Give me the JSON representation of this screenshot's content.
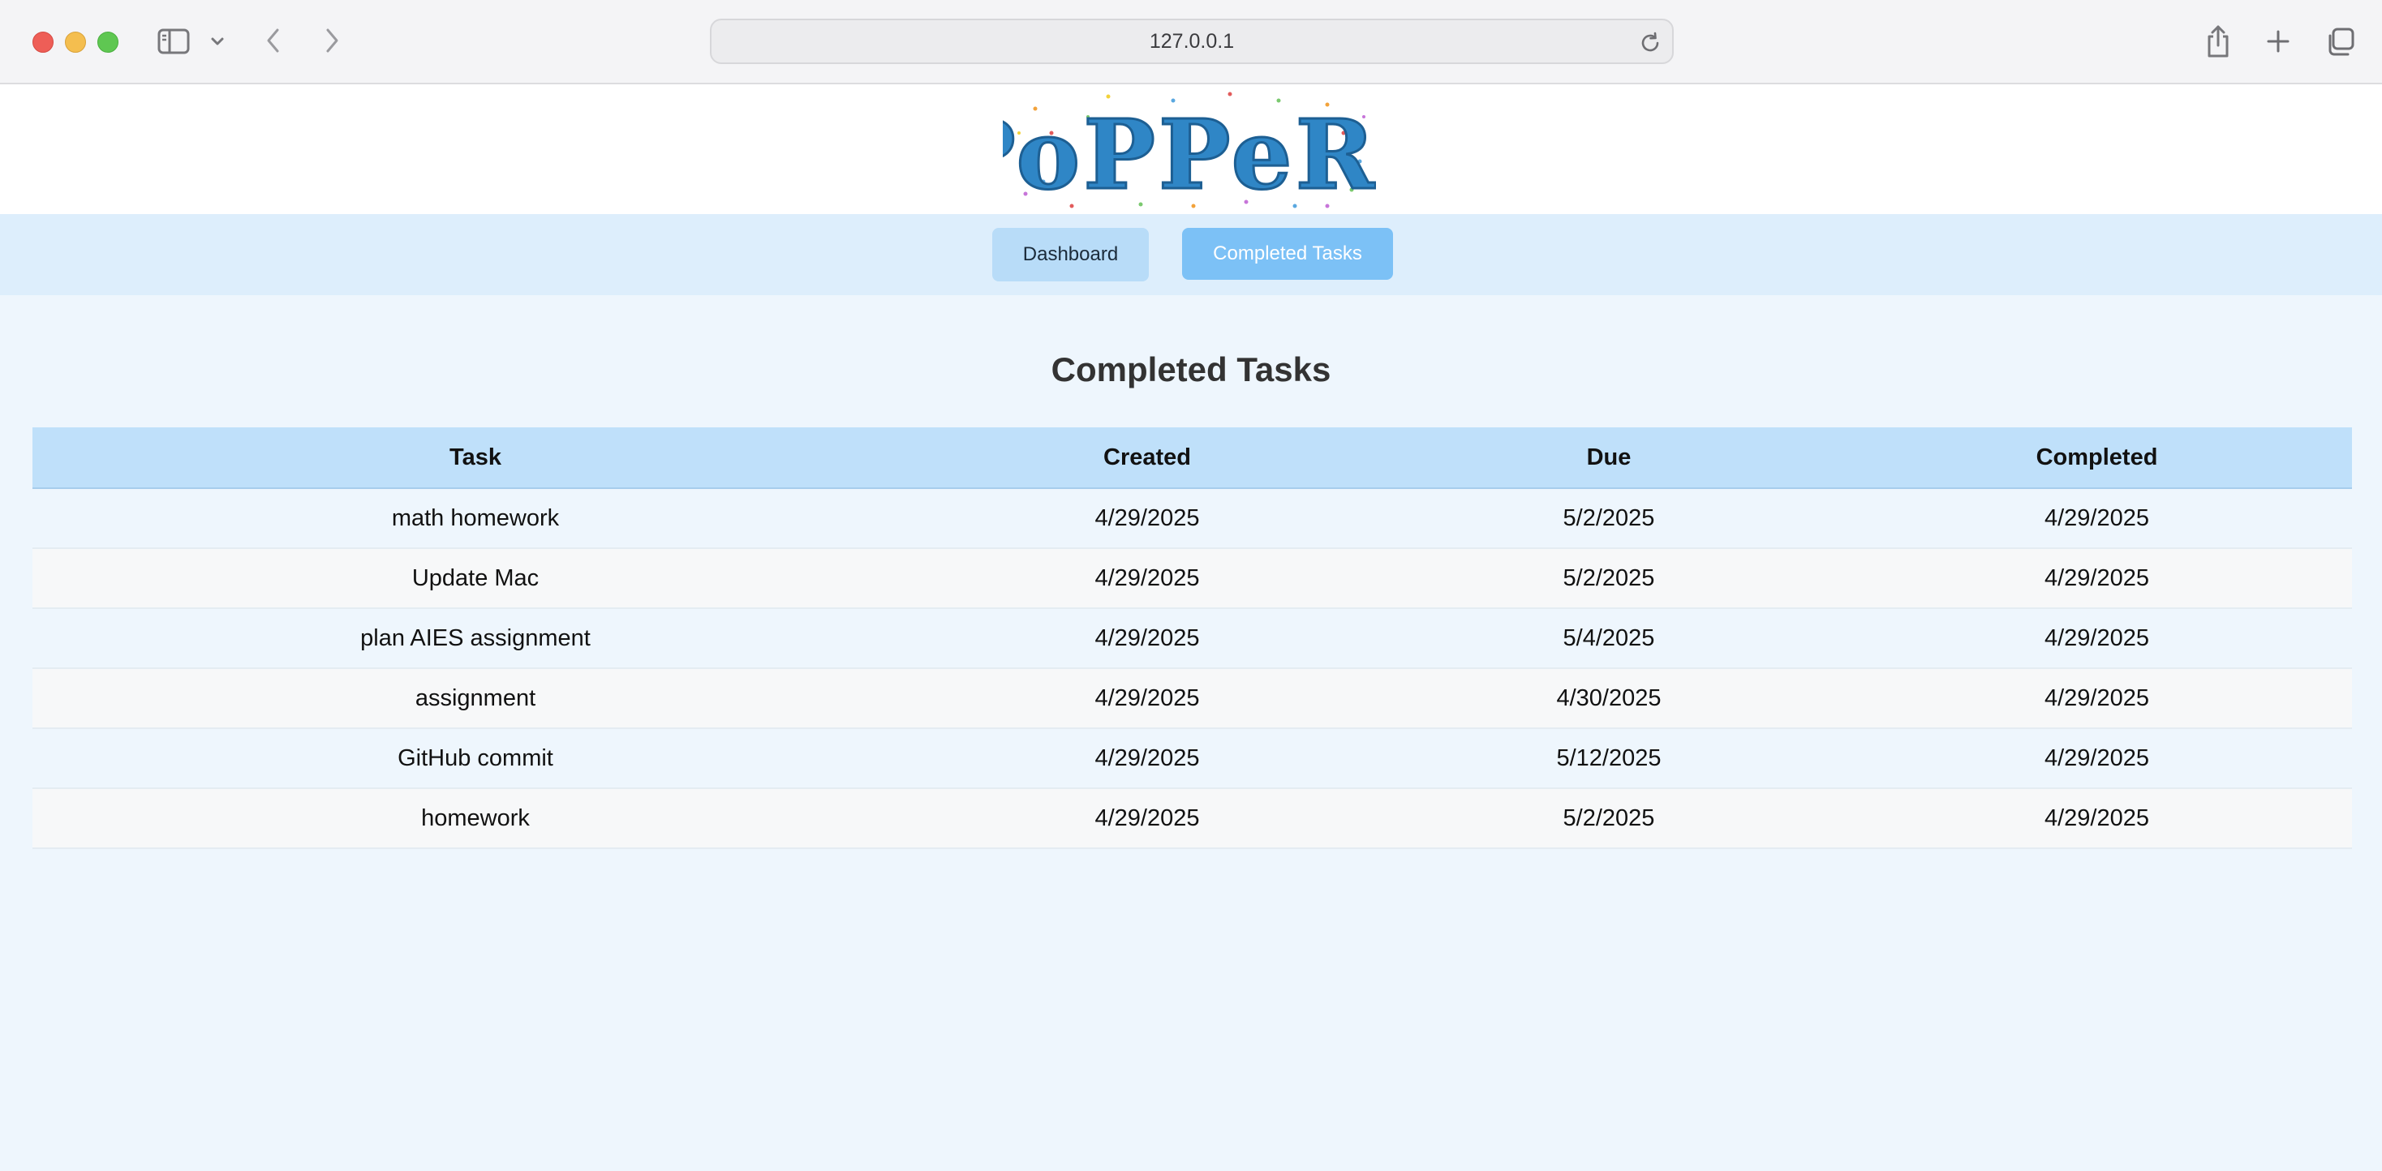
{
  "browser": {
    "url": "127.0.0.1",
    "icons": [
      "sidebar-icon",
      "chevron-down-icon",
      "back-icon",
      "forward-icon",
      "reload-icon",
      "share-icon",
      "plus-icon",
      "tabs-icon"
    ]
  },
  "header": {
    "logo_text": "PoPPeRs"
  },
  "nav": {
    "dashboard_label": "Dashboard",
    "completed_label": "Completed Tasks"
  },
  "main": {
    "title": "Completed Tasks",
    "columns": [
      "Task",
      "Created",
      "Due",
      "Completed"
    ],
    "rows": [
      [
        "math homework",
        "4/29/2025",
        "5/2/2025",
        "4/29/2025"
      ],
      [
        "Update Mac",
        "4/29/2025",
        "5/2/2025",
        "4/29/2025"
      ],
      [
        "plan AIES assignment",
        "4/29/2025",
        "5/4/2025",
        "4/29/2025"
      ],
      [
        "assignment",
        "4/29/2025",
        "4/30/2025",
        "4/29/2025"
      ],
      [
        "GitHub commit",
        "4/29/2025",
        "5/12/2025",
        "4/29/2025"
      ],
      [
        "homework",
        "4/29/2025",
        "5/2/2025",
        "4/29/2025"
      ]
    ]
  },
  "colors": {
    "accent": "#7cc1f6",
    "nav_bg": "#ddeefc",
    "table_header": "#bfe0fa",
    "logo_blue": "#2f86c6",
    "page_bg": "#eef6fd"
  }
}
